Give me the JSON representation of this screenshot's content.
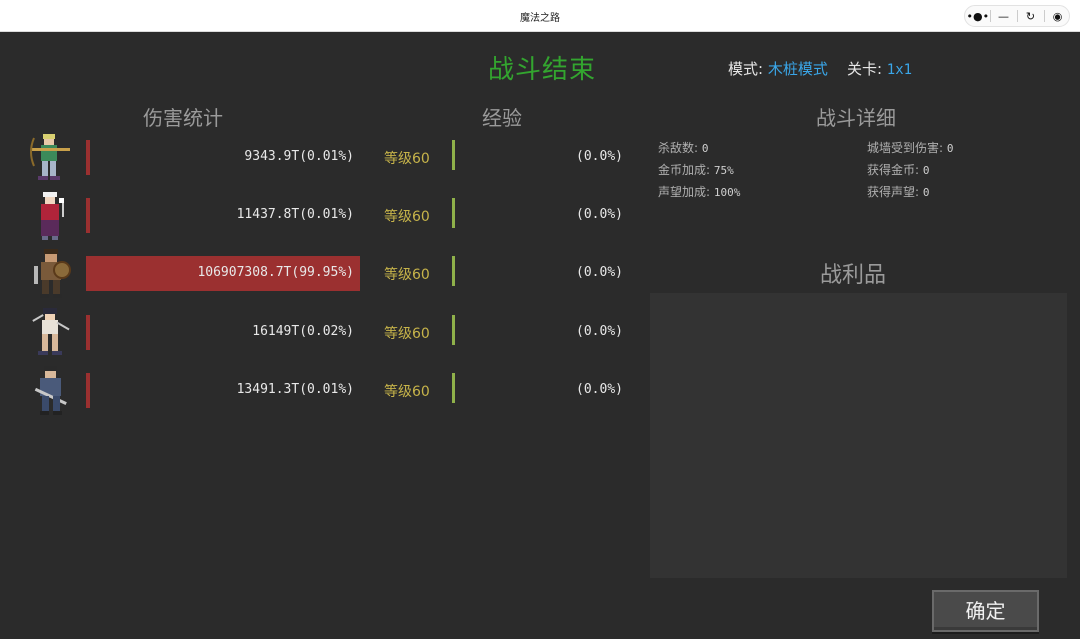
{
  "window": {
    "title": "魔法之路",
    "controls": {
      "menu": "•●•",
      "minimize": "—",
      "restart": "↻",
      "record": "◉"
    }
  },
  "header": {
    "title": "战斗结束",
    "mode_label": "模式:",
    "mode_value": "木桩模式",
    "level_label": "关卡:",
    "level_value": "1x1"
  },
  "sections": {
    "damage": "伤害统计",
    "exp": "经验",
    "details": "战斗详细",
    "loot": "战利品"
  },
  "heroes": [
    {
      "name": "archer-hero",
      "damage": "9343.9T(0.01%)",
      "share": 0.0001,
      "level": "等级60",
      "exp": "(0.0%)"
    },
    {
      "name": "mage-hero",
      "damage": "11437.8T(0.01%)",
      "share": 0.0001,
      "level": "等级60",
      "exp": "(0.0%)"
    },
    {
      "name": "warrior-hero",
      "damage": "106907308.7T(99.95%)",
      "share": 0.9995,
      "level": "等级60",
      "exp": "(0.0%)"
    },
    {
      "name": "rogue-hero",
      "damage": "16149T(0.02%)",
      "share": 0.0002,
      "level": "等级60",
      "exp": "(0.0%)"
    },
    {
      "name": "knight-hero",
      "damage": "13491.3T(0.01%)",
      "share": 0.0001,
      "level": "等级60",
      "exp": "(0.0%)"
    }
  ],
  "details": {
    "kills_label": "杀敌数:",
    "kills": "0",
    "wall_damage_label": "城墙受到伤害:",
    "wall_damage": "0",
    "gold_bonus_label": "金币加成:",
    "gold_bonus": "75%",
    "gold_gained_label": "获得金币:",
    "gold_gained": "0",
    "fame_bonus_label": "声望加成:",
    "fame_bonus": "100%",
    "fame_gained_label": "获得声望:",
    "fame_gained": "0"
  },
  "buttons": {
    "confirm": "确定"
  },
  "colors": {
    "title_green": "#33a52f",
    "damage_bar": "#9b3030",
    "level_gold": "#c7b44a",
    "exp_bar": "#8fb14a",
    "mode_blue": "#3aa6e8"
  }
}
